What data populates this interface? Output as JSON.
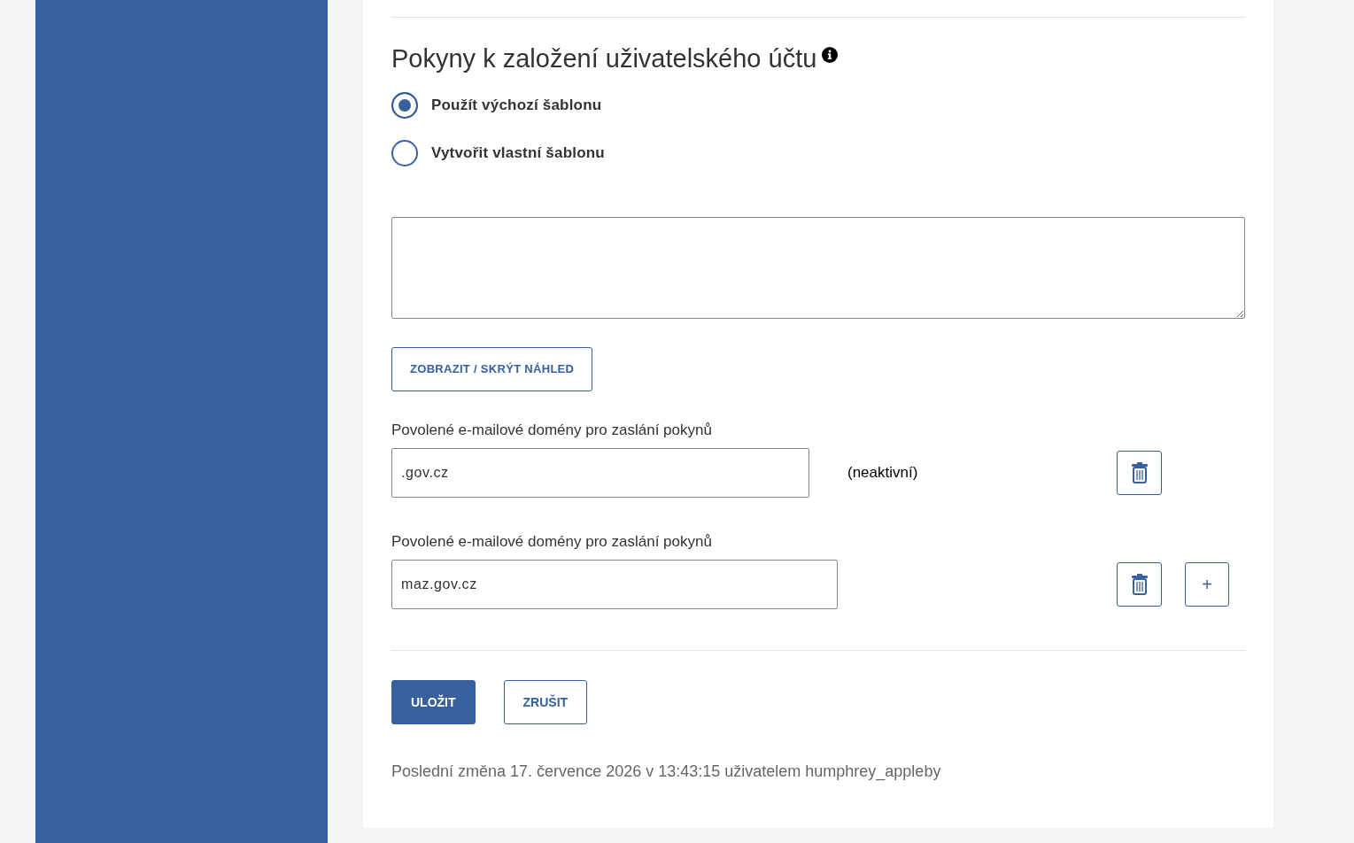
{
  "section": {
    "title": "Pokyny k založení uživatelského účtu"
  },
  "template_options": [
    {
      "label": "Použít výchozí šablonu",
      "selected": true
    },
    {
      "label": "Vytvořit vlastní šablonu",
      "selected": false
    }
  ],
  "preview_button": {
    "label": "ZOBRAZIT / SKRÝT NÁHLED"
  },
  "domains": [
    {
      "label": "Povolené e-mailové domény pro zaslání pokynů",
      "value": ".gov.cz",
      "status": "(neaktivní)",
      "actions": [
        {
          "kind": "delete"
        }
      ]
    },
    {
      "label": "Povolené e-mailové domény pro zaslání pokynů",
      "value": "maz.gov.cz",
      "actions": [
        {
          "kind": "delete"
        },
        {
          "kind": "add",
          "label": "+"
        }
      ]
    }
  ],
  "form_actions": [
    {
      "label": "ULOŽIT",
      "kind": "primary"
    },
    {
      "label": "ZRUŠIT",
      "kind": "secondary"
    }
  ],
  "last_change": "Poslední změna 17. července 2026 v 13:43:15 uživatelem humphrey_appleby"
}
